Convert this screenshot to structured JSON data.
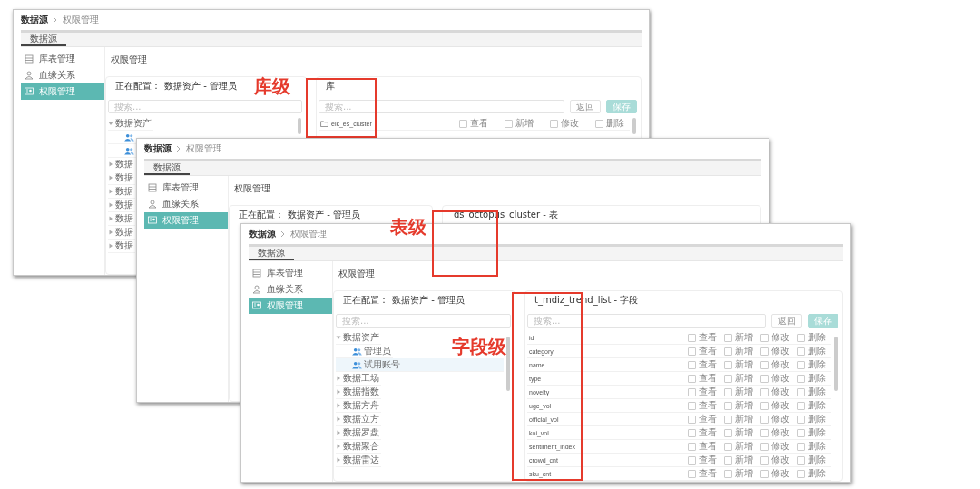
{
  "windows": [
    {
      "breadcrumb": {
        "root": "数据源",
        "current": "权限管理"
      },
      "tab": {
        "label": "数据源",
        "selected": true
      },
      "sidebar": [
        {
          "kind": "table",
          "label": "库表管理",
          "selected": false
        },
        {
          "kind": "lineage",
          "label": "血缘关系",
          "selected": false
        },
        {
          "kind": "permission",
          "label": "权限管理",
          "selected": true
        }
      ],
      "heading": "权限管理",
      "config": {
        "label": "正在配置：",
        "value": "数据资产 - 管理员"
      },
      "tree": {
        "placeholder": "搜索...",
        "items": [
          {
            "label": "数据资产",
            "expanded": true,
            "children": [
              {
                "selected": false
              },
              {
                "selected": false
              }
            ]
          },
          {
            "label": "数据",
            "expanded": false
          },
          {
            "label": "数据",
            "expanded": false
          },
          {
            "label": "数据",
            "expanded": false
          },
          {
            "label": "数据",
            "expanded": false
          },
          {
            "label": "数据",
            "expanded": false
          },
          {
            "label": "数据",
            "expanded": false
          },
          {
            "label": "数据",
            "expanded": false
          }
        ]
      },
      "detail": {
        "title": "库",
        "placeholder": "搜索...",
        "buttons": [
          {
            "kind": "plain",
            "label": "返回"
          },
          {
            "kind": "primary",
            "label": "保存"
          }
        ],
        "rows": [
          {
            "kind": "database",
            "name": "elk_es_cluster",
            "perms": [
              {
                "label": "查看",
                "checked": false
              },
              {
                "label": "新增",
                "checked": false
              },
              {
                "label": "修改",
                "checked": false
              },
              {
                "label": "删除",
                "checked": false
              }
            ]
          }
        ]
      }
    },
    {
      "breadcrumb": {
        "root": "数据源",
        "current": "权限管理"
      },
      "tab": {
        "label": "数据源",
        "selected": true
      },
      "sidebar": [
        {
          "kind": "table",
          "label": "库表管理",
          "selected": false
        },
        {
          "kind": "lineage",
          "label": "血缘关系",
          "selected": false
        },
        {
          "kind": "permission",
          "label": "权限管理",
          "selected": true
        }
      ],
      "heading": "权限管理",
      "config": {
        "label": "正在配置：",
        "value": "数据资产 - 管理员"
      },
      "detail": {
        "title": "ds_octopus_cluster - 表"
      }
    },
    {
      "breadcrumb": {
        "root": "数据源",
        "current": "权限管理"
      },
      "tab": {
        "label": "数据源",
        "selected": true
      },
      "sidebar": [
        {
          "kind": "table",
          "label": "库表管理",
          "selected": false
        },
        {
          "kind": "lineage",
          "label": "血缘关系",
          "selected": false
        },
        {
          "kind": "permission",
          "label": "权限管理",
          "selected": true
        }
      ],
      "heading": "权限管理",
      "config": {
        "label": "正在配置：",
        "value": "数据资产 - 管理员"
      },
      "tree": {
        "placeholder": "搜索...",
        "items": [
          {
            "label": "数据资产",
            "expanded": true,
            "children": [
              {
                "label": "管理员",
                "selected": false
              },
              {
                "label": "试用账号",
                "selected": true
              }
            ]
          },
          {
            "label": "数据工场",
            "expanded": false
          },
          {
            "label": "数据指数",
            "expanded": false
          },
          {
            "label": "数据方舟",
            "expanded": false
          },
          {
            "label": "数据立方",
            "expanded": false
          },
          {
            "label": "数据罗盘",
            "expanded": false
          },
          {
            "label": "数据聚合",
            "expanded": false
          },
          {
            "label": "数据雷达",
            "expanded": false
          }
        ]
      },
      "detail": {
        "title": "t_mdiz_trend_list - 字段",
        "placeholder": "搜索...",
        "buttons": [
          {
            "kind": "plain",
            "label": "返回"
          },
          {
            "kind": "primary",
            "label": "保存"
          }
        ],
        "rows": [
          {
            "kind": "field",
            "name": "id",
            "perms": [
              {
                "label": "查看",
                "checked": false
              },
              {
                "label": "新增",
                "checked": false
              },
              {
                "label": "修改",
                "checked": false
              },
              {
                "label": "删除",
                "checked": false
              }
            ]
          },
          {
            "kind": "field",
            "name": "category",
            "perms": [
              {
                "label": "查看",
                "checked": false
              },
              {
                "label": "新增",
                "checked": false
              },
              {
                "label": "修改",
                "checked": false
              },
              {
                "label": "删除",
                "checked": false
              }
            ]
          },
          {
            "kind": "field",
            "name": "name",
            "perms": [
              {
                "label": "查看",
                "checked": false
              },
              {
                "label": "新增",
                "checked": false
              },
              {
                "label": "修改",
                "checked": false
              },
              {
                "label": "删除",
                "checked": false
              }
            ]
          },
          {
            "kind": "field",
            "name": "type",
            "perms": [
              {
                "label": "查看",
                "checked": false
              },
              {
                "label": "新增",
                "checked": false
              },
              {
                "label": "修改",
                "checked": false
              },
              {
                "label": "删除",
                "checked": false
              }
            ]
          },
          {
            "kind": "field",
            "name": "novelty",
            "perms": [
              {
                "label": "查看",
                "checked": false
              },
              {
                "label": "新增",
                "checked": false
              },
              {
                "label": "修改",
                "checked": false
              },
              {
                "label": "删除",
                "checked": false
              }
            ]
          },
          {
            "kind": "field",
            "name": "ugc_vol",
            "perms": [
              {
                "label": "查看",
                "checked": false
              },
              {
                "label": "新增",
                "checked": false
              },
              {
                "label": "修改",
                "checked": false
              },
              {
                "label": "删除",
                "checked": false
              }
            ]
          },
          {
            "kind": "field",
            "name": "official_vol",
            "perms": [
              {
                "label": "查看",
                "checked": false
              },
              {
                "label": "新增",
                "checked": false
              },
              {
                "label": "修改",
                "checked": false
              },
              {
                "label": "删除",
                "checked": false
              }
            ]
          },
          {
            "kind": "field",
            "name": "koi_vol",
            "perms": [
              {
                "label": "查看",
                "checked": false
              },
              {
                "label": "新增",
                "checked": false
              },
              {
                "label": "修改",
                "checked": false
              },
              {
                "label": "删除",
                "checked": false
              }
            ]
          },
          {
            "kind": "field",
            "name": "sentiment_index",
            "perms": [
              {
                "label": "查看",
                "checked": false
              },
              {
                "label": "新增",
                "checked": false
              },
              {
                "label": "修改",
                "checked": false
              },
              {
                "label": "删除",
                "checked": false
              }
            ]
          },
          {
            "kind": "field",
            "name": "crowd_cnt",
            "perms": [
              {
                "label": "查看",
                "checked": false
              },
              {
                "label": "新增",
                "checked": false
              },
              {
                "label": "修改",
                "checked": false
              },
              {
                "label": "删除",
                "checked": false
              }
            ]
          },
          {
            "kind": "field",
            "name": "sku_cnt",
            "perms": [
              {
                "label": "查看",
                "checked": false
              },
              {
                "label": "新增",
                "checked": false
              },
              {
                "label": "修改",
                "checked": false
              },
              {
                "label": "删除",
                "checked": false
              }
            ]
          }
        ]
      }
    }
  ],
  "annotations": [
    {
      "label": "库级"
    },
    {
      "label": "表级"
    },
    {
      "label": "字段级"
    }
  ]
}
